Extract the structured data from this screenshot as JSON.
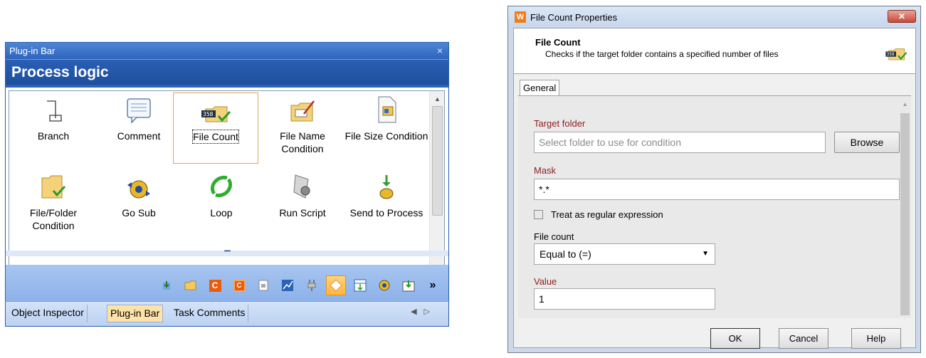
{
  "plugin_bar": {
    "title": "Plug-in Bar",
    "close_glyph": "×",
    "section_title": "Process logic",
    "items": [
      {
        "label": "Branch",
        "icon": "branch-icon"
      },
      {
        "label": "Comment",
        "icon": "comment-icon"
      },
      {
        "label": "File Count",
        "icon": "file-count-icon",
        "selected": true
      },
      {
        "label": "File Name Condition",
        "icon": "file-name-condition-icon"
      },
      {
        "label": "File Size Condition",
        "icon": "file-size-condition-icon"
      },
      {
        "label": "File/Folder Condition",
        "icon": "file-folder-condition-icon"
      },
      {
        "label": "Go Sub",
        "icon": "go-sub-icon"
      },
      {
        "label": "Loop",
        "icon": "loop-icon"
      },
      {
        "label": "Run Script",
        "icon": "run-script-icon"
      },
      {
        "label": "Send to Process",
        "icon": "send-to-process-icon"
      }
    ],
    "bottom_tabs": [
      "Object Inspector",
      "Plug-in Bar",
      "Task Comments"
    ],
    "active_tab": "Plug-in Bar",
    "more_glyph": "»"
  },
  "dialog": {
    "title": "File Count Properties",
    "app_icon_letter": "W",
    "close_glyph": "✕",
    "header_title": "File Count",
    "header_desc": "Checks if the target folder contains a specified number of files",
    "tab_general": "General",
    "target_folder_label": "Target folder",
    "target_folder_placeholder": "Select folder to use for condition",
    "browse_label": "Browse",
    "mask_label": "Mask",
    "mask_value": "*.*",
    "regex_label": "Treat as regular expression",
    "file_count_label": "File count",
    "file_count_value": "Equal to (=)",
    "value_label": "Value",
    "value_value": "1",
    "ok_label": "OK",
    "cancel_label": "Cancel",
    "help_label": "Help"
  }
}
